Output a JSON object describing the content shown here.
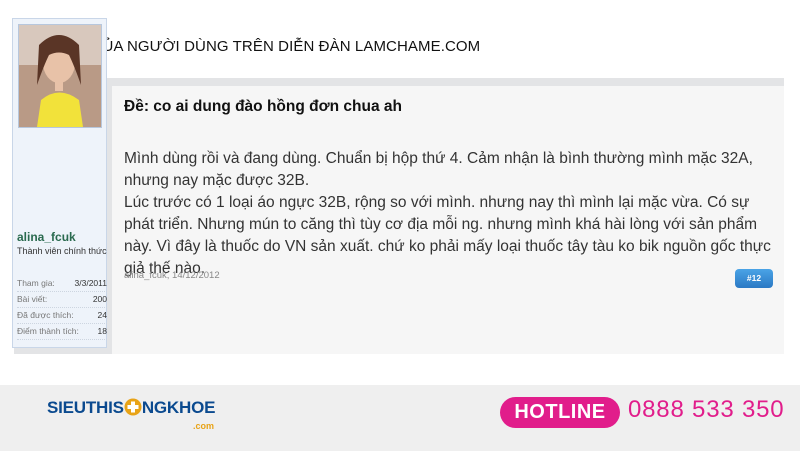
{
  "page_heading": "PHẢN HỒI CỦA NGƯỜI DÙNG TRÊN DIỄN ĐÀN LAMCHAME.COM",
  "user": {
    "username": "alina_fcuk",
    "title": "Thành viên chính thức",
    "stats": [
      {
        "label": "Tham gia:",
        "value": "3/3/2011"
      },
      {
        "label": "Bài viết:",
        "value": "200"
      },
      {
        "label": "Đã được thích:",
        "value": "24"
      },
      {
        "label": "Điểm thành tích:",
        "value": "18"
      }
    ]
  },
  "post": {
    "title": "Đề: co ai dung đào hồng đơn chua ah",
    "paragraphs": [
      "Mình dùng rồi và đang dùng. Chuẩn bị hộp thứ 4. Cảm nhận là bình thường mình mặc 32A, nhưng nay mặc được 32B.",
      "Lúc trước có 1 loại áo ngực 32B, rộng so với mình. nhưng nay thì mình lại mặc vừa. Có sự phát triển. Nhưng mún to căng thì tùy cơ địa mỗi ng. nhưng mình khá hài lòng với sản phẩm này. Vì đây là thuốc do VN sản xuất. chứ ko phải mấy loại thuốc tây tàu ko bik nguồn gốc thực giả thế nào."
    ],
    "meta": "alina_fcuk, 14/12/2012",
    "number": "#12"
  },
  "footer": {
    "logo_part1": "SIEUTHIS",
    "logo_part2": "NGKHOE",
    "logo_domain": ".com",
    "hotline_label": "HOTLINE",
    "hotline_number": "0888 533 350",
    "colors": {
      "brand": "#0b4a8f",
      "accent": "#e11d8b",
      "cross": "#e8a317"
    }
  }
}
